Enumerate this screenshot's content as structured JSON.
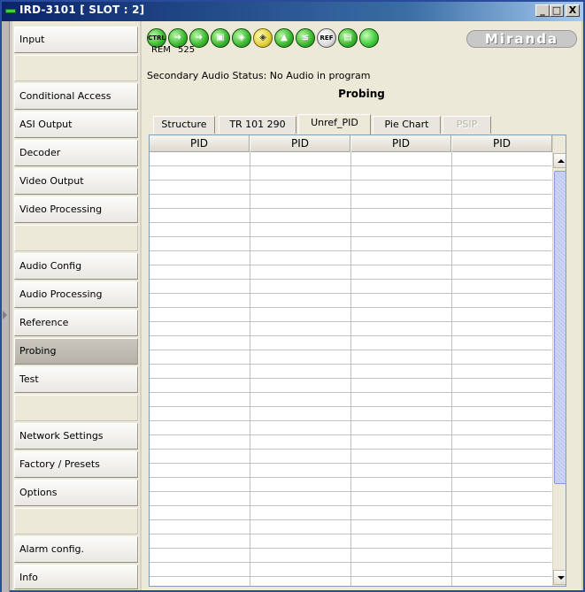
{
  "window": {
    "title": "IRD-3101 [ SLOT : 2]",
    "controls": {
      "minimize": "_",
      "maximize": "□",
      "close": "X"
    }
  },
  "sidebar": {
    "items": [
      {
        "label": "Input"
      },
      {
        "label": ""
      },
      {
        "label": "Conditional Access"
      },
      {
        "label": "ASI Output"
      },
      {
        "label": "Decoder"
      },
      {
        "label": "Video Output"
      },
      {
        "label": "Video Processing"
      },
      {
        "label": ""
      },
      {
        "label": "Audio Config"
      },
      {
        "label": "Audio Processing"
      },
      {
        "label": "Reference"
      },
      {
        "label": "Probing"
      },
      {
        "label": "Test"
      },
      {
        "label": ""
      },
      {
        "label": "Network Settings"
      },
      {
        "label": "Factory / Presets"
      },
      {
        "label": "Options"
      },
      {
        "label": ""
      },
      {
        "label": "Alarm config."
      },
      {
        "label": "Info"
      }
    ],
    "active": "Probing"
  },
  "status_icons": {
    "ctrl_label": "CTRL",
    "ref_label": "REF",
    "rem_caption": "REM",
    "format_caption": "525"
  },
  "brand": {
    "logo_text": "Miranda"
  },
  "secondary_status": "Secondary Audio Status: No Audio in program",
  "page_title": "Probing",
  "tabs": [
    {
      "label": "Structure"
    },
    {
      "label": "TR 101 290"
    },
    {
      "label": "Unref_PID"
    },
    {
      "label": "Pie Chart"
    },
    {
      "label": "PSIP"
    }
  ],
  "active_tab": "Unref_PID",
  "table": {
    "columns": [
      "PID",
      "PID",
      "PID",
      "PID"
    ],
    "row_count": 30
  },
  "colors": {
    "status_green": "#39b62e",
    "title_bar": "#0a246a",
    "scroll_thumb": "#b9c4ec"
  }
}
